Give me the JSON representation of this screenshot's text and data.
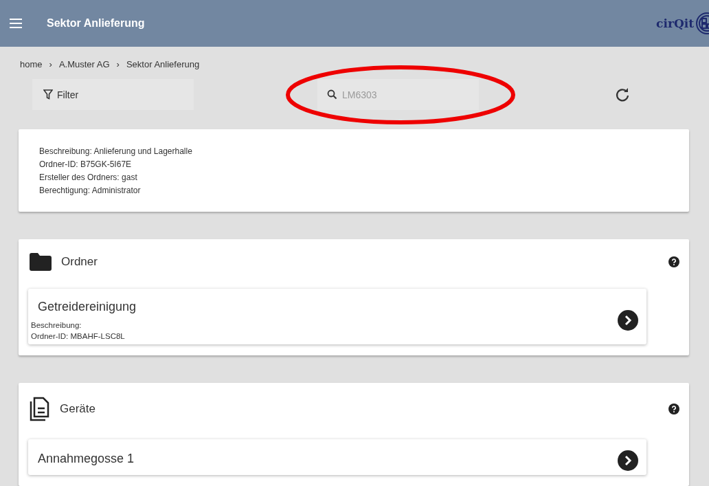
{
  "header": {
    "title": "Sektor Anlieferung",
    "logo": "cirQit"
  },
  "breadcrumb": [
    "home",
    "A.Muster AG",
    "Sektor Anlieferung"
  ],
  "breadcrumb_separator": "›",
  "toolbar": {
    "filter": {
      "label": "Filter"
    },
    "search": {
      "value": "LM6303"
    }
  },
  "annotation": {
    "kind": "ellipse"
  },
  "info": [
    "Beschreibung: Anlieferung und Lagerhalle",
    "Ordner-ID: B75GK-5I67E",
    "Ersteller des Ordners: gast",
    "Berechtigung: Administrator"
  ],
  "sections": [
    {
      "kind": "folder",
      "title": "Ordner",
      "items": [
        {
          "title": "Getreidereinigung",
          "lines": [
            "Beschreibung:",
            "Ordner-ID: MBAHF-LSC8L"
          ]
        }
      ]
    },
    {
      "kind": "device",
      "title": "Geräte",
      "items": [
        {
          "title": "Annahmegosse 1"
        }
      ]
    }
  ]
}
